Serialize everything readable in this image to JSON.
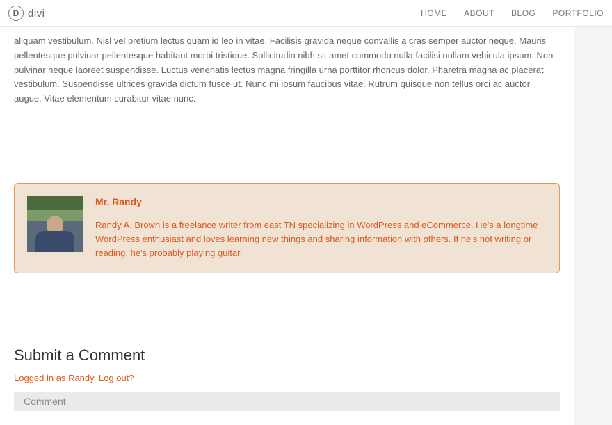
{
  "header": {
    "logo_letter": "D",
    "logo_text": "divi",
    "nav": [
      "HOME",
      "ABOUT",
      "BLOG",
      "PORTFOLIO"
    ]
  },
  "article": {
    "body": "aliquam vestibulum. Nisl vel pretium lectus quam id leo in vitae. Facilisis gravida neque convallis a cras semper auctor neque. Mauris pellentesque pulvinar pellentesque habitant morbi tristique. Sollicitudin nibh sit amet commodo nulla facilisi nullam vehicula ipsum. Non pulvinar neque laoreet suspendisse. Luctus venenatis lectus magna fringilla urna porttitor rhoncus dolor. Pharetra magna ac placerat vestibulum. Suspendisse ultrices gravida dictum fusce ut. Nunc mi ipsum faucibus vitae. Rutrum quisque non tellus orci ac auctor augue. Vitae elementum curabitur vitae nunc."
  },
  "author": {
    "name": "Mr. Randy",
    "bio": "Randy A. Brown is a freelance writer from east TN specializing in WordPress and eCommerce. He's a longtime WordPress enthusiast and loves learning new things and sharing information with others. If he's not writing or reading, he's probably playing guitar."
  },
  "comments": {
    "heading": "Submit a Comment",
    "logged_in_text": "Logged in as Randy",
    "dot": ". ",
    "logout_text": "Log out?",
    "placeholder": "Comment"
  }
}
